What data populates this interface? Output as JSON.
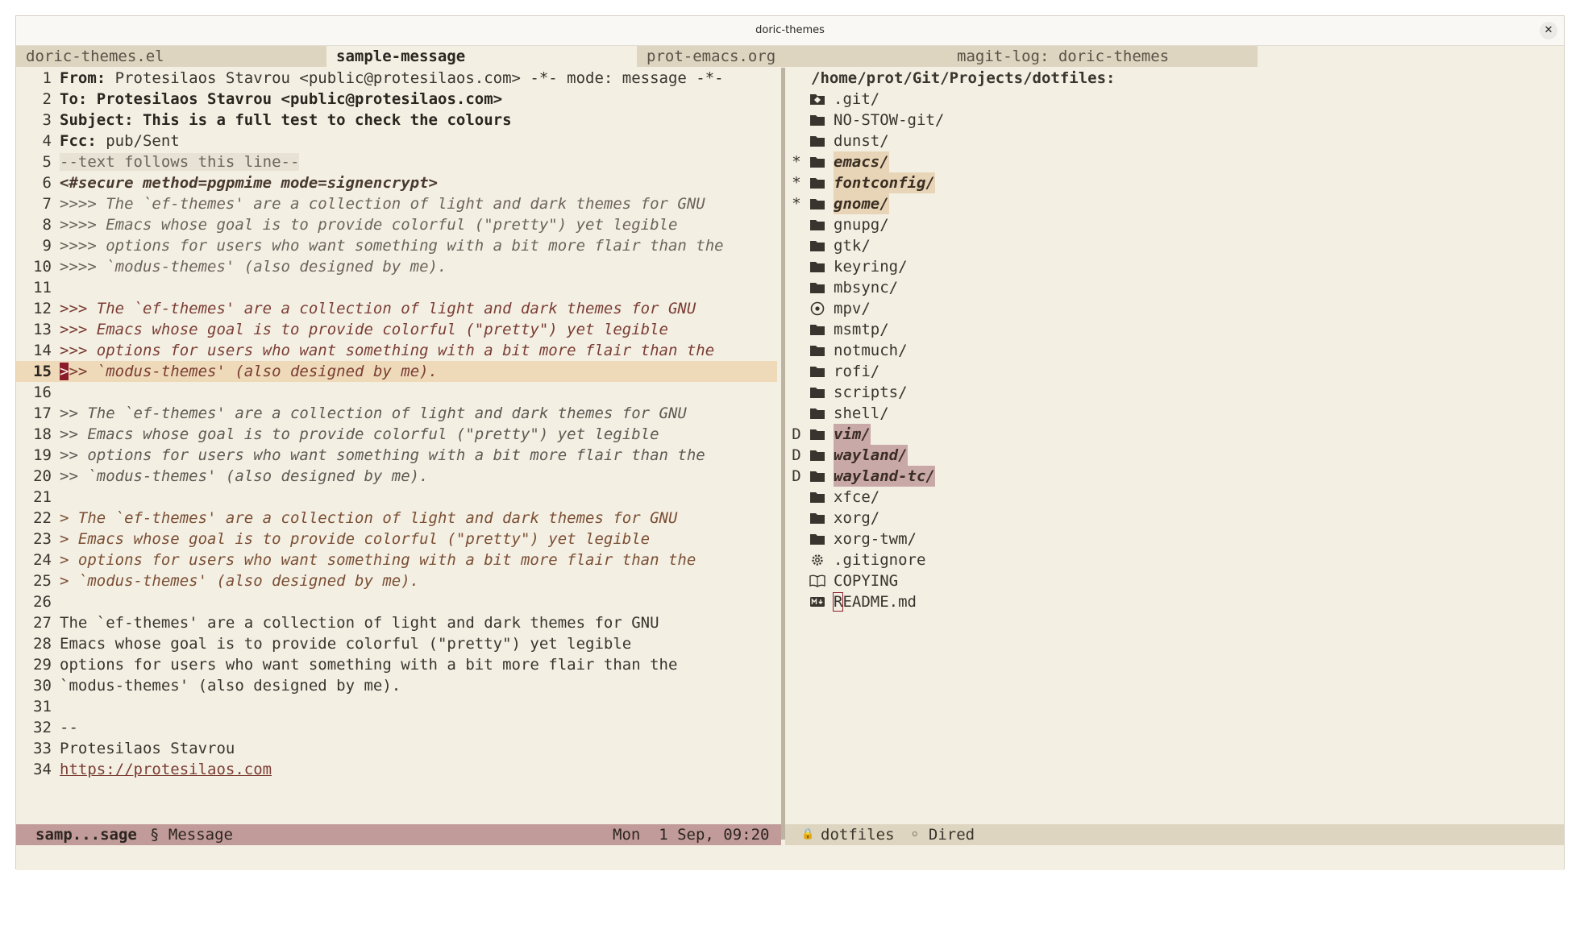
{
  "window": {
    "title": "doric-themes",
    "close_label": "✕"
  },
  "tabs": [
    {
      "label": "doric-themes.el",
      "active": false
    },
    {
      "label": "sample-message",
      "active": true
    },
    {
      "label": "prot-emacs.org",
      "active": false
    },
    {
      "label": "magit-log: doric-themes",
      "active": false
    }
  ],
  "message": {
    "lines": [
      {
        "n": "1",
        "segs": [
          {
            "t": "From: ",
            "c": "b"
          },
          {
            "t": "Protesilaos Stavrou <public@protesilaos.com> -*- mode: message -*-",
            "c": ""
          }
        ]
      },
      {
        "n": "2",
        "segs": [
          {
            "t": "To: ",
            "c": "b"
          },
          {
            "t": "Protesilaos Stavrou <public@protesilaos.com>",
            "c": "b"
          }
        ]
      },
      {
        "n": "3",
        "segs": [
          {
            "t": "Subject: ",
            "c": "b"
          },
          {
            "t": "This is a full test to check the colours",
            "c": "b"
          }
        ]
      },
      {
        "n": "4",
        "segs": [
          {
            "t": "Fcc: ",
            "c": "b"
          },
          {
            "t": "pub/Sent",
            "c": ""
          }
        ]
      },
      {
        "n": "5",
        "segs": [
          {
            "t": "--text follows this line--",
            "c": "sep"
          }
        ]
      },
      {
        "n": "6",
        "segs": [
          {
            "t": "<#secure method=pgpmime mode=signencrypt>",
            "c": "sec"
          }
        ]
      },
      {
        "n": "7",
        "segs": [
          {
            "t": ">>>> The `ef-themes' are a collection of light and dark themes for GNU",
            "c": "q4"
          }
        ]
      },
      {
        "n": "8",
        "segs": [
          {
            "t": ">>>> Emacs whose goal is to provide colorful (\"pretty\") yet legible",
            "c": "q4"
          }
        ]
      },
      {
        "n": "9",
        "segs": [
          {
            "t": ">>>> options for users who want something with a bit more flair than the",
            "c": "q4"
          }
        ]
      },
      {
        "n": "10",
        "segs": [
          {
            "t": ">>>> `modus-themes' (also designed by me).",
            "c": "q4"
          }
        ]
      },
      {
        "n": "11",
        "segs": []
      },
      {
        "n": "12",
        "segs": [
          {
            "t": ">>> The `ef-themes' are a collection of light and dark themes for GNU",
            "c": "q3"
          }
        ]
      },
      {
        "n": "13",
        "segs": [
          {
            "t": ">>> Emacs whose goal is to provide colorful (\"pretty\") yet legible",
            "c": "q3"
          }
        ]
      },
      {
        "n": "14",
        "segs": [
          {
            "t": ">>> options for users who want something with a bit more flair than the",
            "c": "q3"
          }
        ]
      },
      {
        "n": "15",
        "current": true,
        "segs": [
          {
            "t": ">",
            "c": "cursor"
          },
          {
            "t": ">> `modus-themes' (also designed by me).",
            "c": "q3"
          }
        ]
      },
      {
        "n": "16",
        "segs": []
      },
      {
        "n": "17",
        "segs": [
          {
            "t": ">> The `ef-themes' are a collection of light and dark themes for GNU",
            "c": "q2"
          }
        ]
      },
      {
        "n": "18",
        "segs": [
          {
            "t": ">> Emacs whose goal is to provide colorful (\"pretty\") yet legible",
            "c": "q2"
          }
        ]
      },
      {
        "n": "19",
        "segs": [
          {
            "t": ">> options for users who want something with a bit more flair than the",
            "c": "q2"
          }
        ]
      },
      {
        "n": "20",
        "segs": [
          {
            "t": ">> `modus-themes' (also designed by me).",
            "c": "q2"
          }
        ]
      },
      {
        "n": "21",
        "segs": []
      },
      {
        "n": "22",
        "segs": [
          {
            "t": "> The `ef-themes' are a collection of light and dark themes for GNU",
            "c": "q1"
          }
        ]
      },
      {
        "n": "23",
        "segs": [
          {
            "t": "> Emacs whose goal is to provide colorful (\"pretty\") yet legible",
            "c": "q1"
          }
        ]
      },
      {
        "n": "24",
        "segs": [
          {
            "t": "> options for users who want something with a bit more flair than the",
            "c": "q1"
          }
        ]
      },
      {
        "n": "25",
        "segs": [
          {
            "t": "> `modus-themes' (also designed by me).",
            "c": "q1"
          }
        ]
      },
      {
        "n": "26",
        "segs": []
      },
      {
        "n": "27",
        "segs": [
          {
            "t": "The `ef-themes' are a collection of light and dark themes for GNU",
            "c": ""
          }
        ]
      },
      {
        "n": "28",
        "segs": [
          {
            "t": "Emacs whose goal is to provide colorful (\"pretty\") yet legible",
            "c": ""
          }
        ]
      },
      {
        "n": "29",
        "segs": [
          {
            "t": "options for users who want something with a bit more flair than the",
            "c": ""
          }
        ]
      },
      {
        "n": "30",
        "segs": [
          {
            "t": "`modus-themes' (also designed by me).",
            "c": ""
          }
        ]
      },
      {
        "n": "31",
        "segs": []
      },
      {
        "n": "32",
        "segs": [
          {
            "t": "--",
            "c": ""
          }
        ]
      },
      {
        "n": "33",
        "segs": [
          {
            "t": "Protesilaos Stavrou",
            "c": ""
          }
        ]
      },
      {
        "n": "34",
        "segs": [
          {
            "t": "https://protesilaos.com",
            "c": "link"
          }
        ]
      }
    ]
  },
  "dired": {
    "header": "/home/prot/Git/Projects/dotfiles:",
    "entries": [
      {
        "mark": "",
        "icon": "git-icon",
        "name": ".git/",
        "style": ""
      },
      {
        "mark": "",
        "icon": "folder-icon",
        "name": "NO-STOW-git/",
        "style": ""
      },
      {
        "mark": "",
        "icon": "folder-icon",
        "name": "dunst/",
        "style": ""
      },
      {
        "mark": "*",
        "icon": "folder-icon",
        "name": "emacs/",
        "style": "dirmark"
      },
      {
        "mark": "*",
        "icon": "folder-icon",
        "name": "fontconfig/",
        "style": "dirmark"
      },
      {
        "mark": "*",
        "icon": "folder-icon",
        "name": "gnome/",
        "style": "dirmark"
      },
      {
        "mark": "",
        "icon": "folder-icon",
        "name": "gnupg/",
        "style": ""
      },
      {
        "mark": "",
        "icon": "folder-icon",
        "name": "gtk/",
        "style": ""
      },
      {
        "mark": "",
        "icon": "folder-icon",
        "name": "keyring/",
        "style": ""
      },
      {
        "mark": "",
        "icon": "folder-icon",
        "name": "mbsync/",
        "style": ""
      },
      {
        "mark": "",
        "icon": "disc-icon",
        "name": "mpv/",
        "style": ""
      },
      {
        "mark": "",
        "icon": "folder-icon",
        "name": "msmtp/",
        "style": ""
      },
      {
        "mark": "",
        "icon": "folder-icon",
        "name": "notmuch/",
        "style": ""
      },
      {
        "mark": "",
        "icon": "folder-icon",
        "name": "rofi/",
        "style": ""
      },
      {
        "mark": "",
        "icon": "folder-icon",
        "name": "scripts/",
        "style": ""
      },
      {
        "mark": "",
        "icon": "folder-icon",
        "name": "shell/",
        "style": ""
      },
      {
        "mark": "D",
        "icon": "folder-icon",
        "name": "vim/",
        "style": "dirdel"
      },
      {
        "mark": "D",
        "icon": "folder-icon",
        "name": "wayland/",
        "style": "dirdel"
      },
      {
        "mark": "D",
        "icon": "folder-icon",
        "name": "wayland-tc/",
        "style": "dirdel"
      },
      {
        "mark": "",
        "icon": "folder-icon",
        "name": "xfce/",
        "style": ""
      },
      {
        "mark": "",
        "icon": "folder-icon",
        "name": "xorg/",
        "style": ""
      },
      {
        "mark": "",
        "icon": "folder-icon",
        "name": "xorg-twm/",
        "style": ""
      },
      {
        "mark": "",
        "icon": "gear-icon",
        "name": ".gitignore",
        "style": ""
      },
      {
        "mark": "",
        "icon": "book-icon",
        "name": "COPYING",
        "style": ""
      },
      {
        "mark": "",
        "icon": "markdown-icon",
        "name": "README.md",
        "style": "cursor-first"
      }
    ]
  },
  "modeline_left": {
    "buffer": "samp...sage",
    "mode": "§ Message",
    "time": "Mon  1 Sep, 09:20"
  },
  "modeline_right": {
    "lock": "🔒",
    "buffer": "dotfiles",
    "mode": "◦ Dired"
  },
  "colors": {
    "background": "#f4efe3",
    "current_line": "#eed9b9",
    "modeline_active": "#c19b9a",
    "modeline_inactive": "#ddd5bf",
    "cursor": "#8b1c2a"
  }
}
